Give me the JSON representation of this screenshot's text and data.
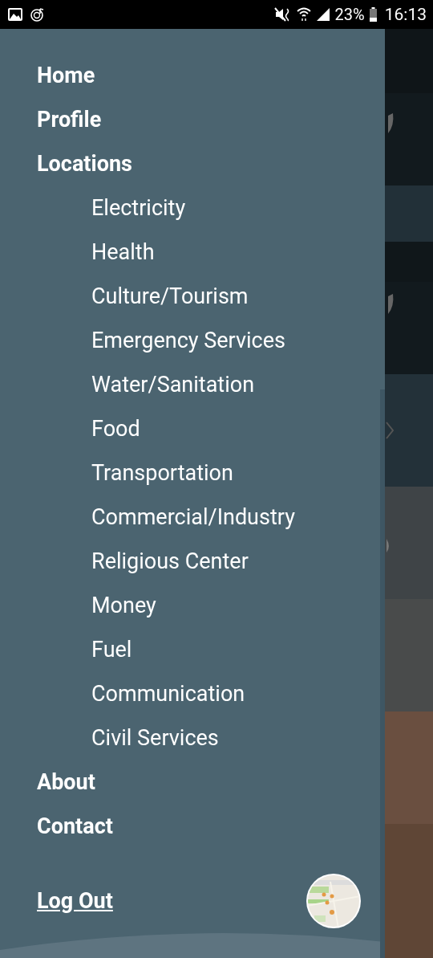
{
  "status_bar": {
    "battery": "23%",
    "time": "16:13"
  },
  "menu": {
    "items": [
      {
        "label": "Home"
      },
      {
        "label": "Profile"
      },
      {
        "label": "Locations",
        "children": [
          {
            "label": "Electricity"
          },
          {
            "label": "Health"
          },
          {
            "label": "Culture/Tourism"
          },
          {
            "label": "Emergency Services"
          },
          {
            "label": "Water/Sanitation"
          },
          {
            "label": "Food"
          },
          {
            "label": "Transportation"
          },
          {
            "label": "Commercial/Industry"
          },
          {
            "label": "Religious Center"
          },
          {
            "label": "Money"
          },
          {
            "label": "Fuel"
          },
          {
            "label": "Communication"
          },
          {
            "label": "Civil Services"
          }
        ]
      },
      {
        "label": "About"
      },
      {
        "label": "Contact"
      }
    ]
  },
  "logout": {
    "label": "Log Out"
  }
}
